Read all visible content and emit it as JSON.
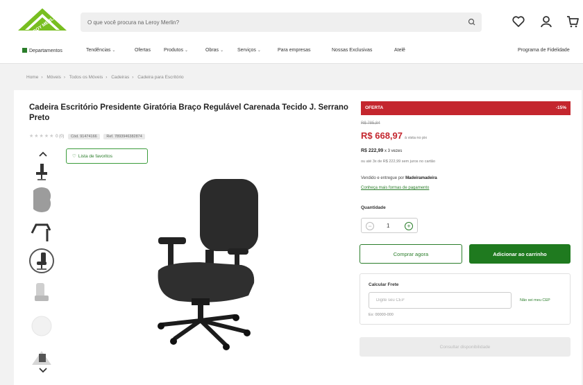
{
  "header": {
    "logo_text": "LEROY MERLIN",
    "search_placeholder": "O que você procura na Leroy Merlin?",
    "colors": {
      "brand_green": "#78be20",
      "dark_green": "#1f7a1f",
      "promo_red": "#c4262e"
    }
  },
  "nav": {
    "items": [
      {
        "label": "Departamentos",
        "chevron": false
      },
      {
        "label": "Tendências",
        "chevron": true
      },
      {
        "label": "Ofertas",
        "chevron": false
      },
      {
        "label": "Produtos",
        "chevron": true
      },
      {
        "label": "Obras",
        "chevron": true
      },
      {
        "label": "Serviços",
        "chevron": true
      },
      {
        "label": "Para empresas",
        "chevron": false
      },
      {
        "label": "Nossas Exclusivas",
        "chevron": false
      },
      {
        "label": "Atelê",
        "chevron": false
      }
    ],
    "right_link": "Programa de Fidelidade"
  },
  "breadcrumb": [
    "Home",
    "Móveis",
    "Todos os Móveis",
    "Cadeiras",
    "Cadeira para Escritório"
  ],
  "product": {
    "title": "Cadeira Escritório Presidente Giratória Braço Regulável Carenada Tecido J. Serrano Preto",
    "stars": "★★★★★",
    "rating": "0 (0)",
    "tags": [
      "Cód. 91474166",
      "Ref. 7893946382874"
    ],
    "favorite_label": "Lista de favoritos"
  },
  "pricing": {
    "promo_label": "OFERTA",
    "discount": "-15%",
    "old_price": "R$ 785,84",
    "price": "R$ 668,97",
    "price_note": "à vista no pix",
    "installment_value": "R$ 222,99",
    "installment_note": "x 3 vezes",
    "installment_sub": "ou até 3x de R$ 222,99 sem juros no cartão",
    "seller_prefix": "Vendido e entregue por",
    "seller_name": "Madeiramadeira",
    "payment_link": "Conheça mais formas de pagamento"
  },
  "purchase": {
    "qty_label": "Quantidade",
    "qty_value": "1",
    "buy_now": "Comprar agora",
    "add_to_cart": "Adicionar ao carrinho"
  },
  "shipping": {
    "title": "Calcular Frete",
    "placeholder": "Digite seu CEP",
    "cep_link": "Não sei meu CEP",
    "note": "Ex: 00000-000"
  },
  "disabled_button": "Consultar disponibilidade"
}
